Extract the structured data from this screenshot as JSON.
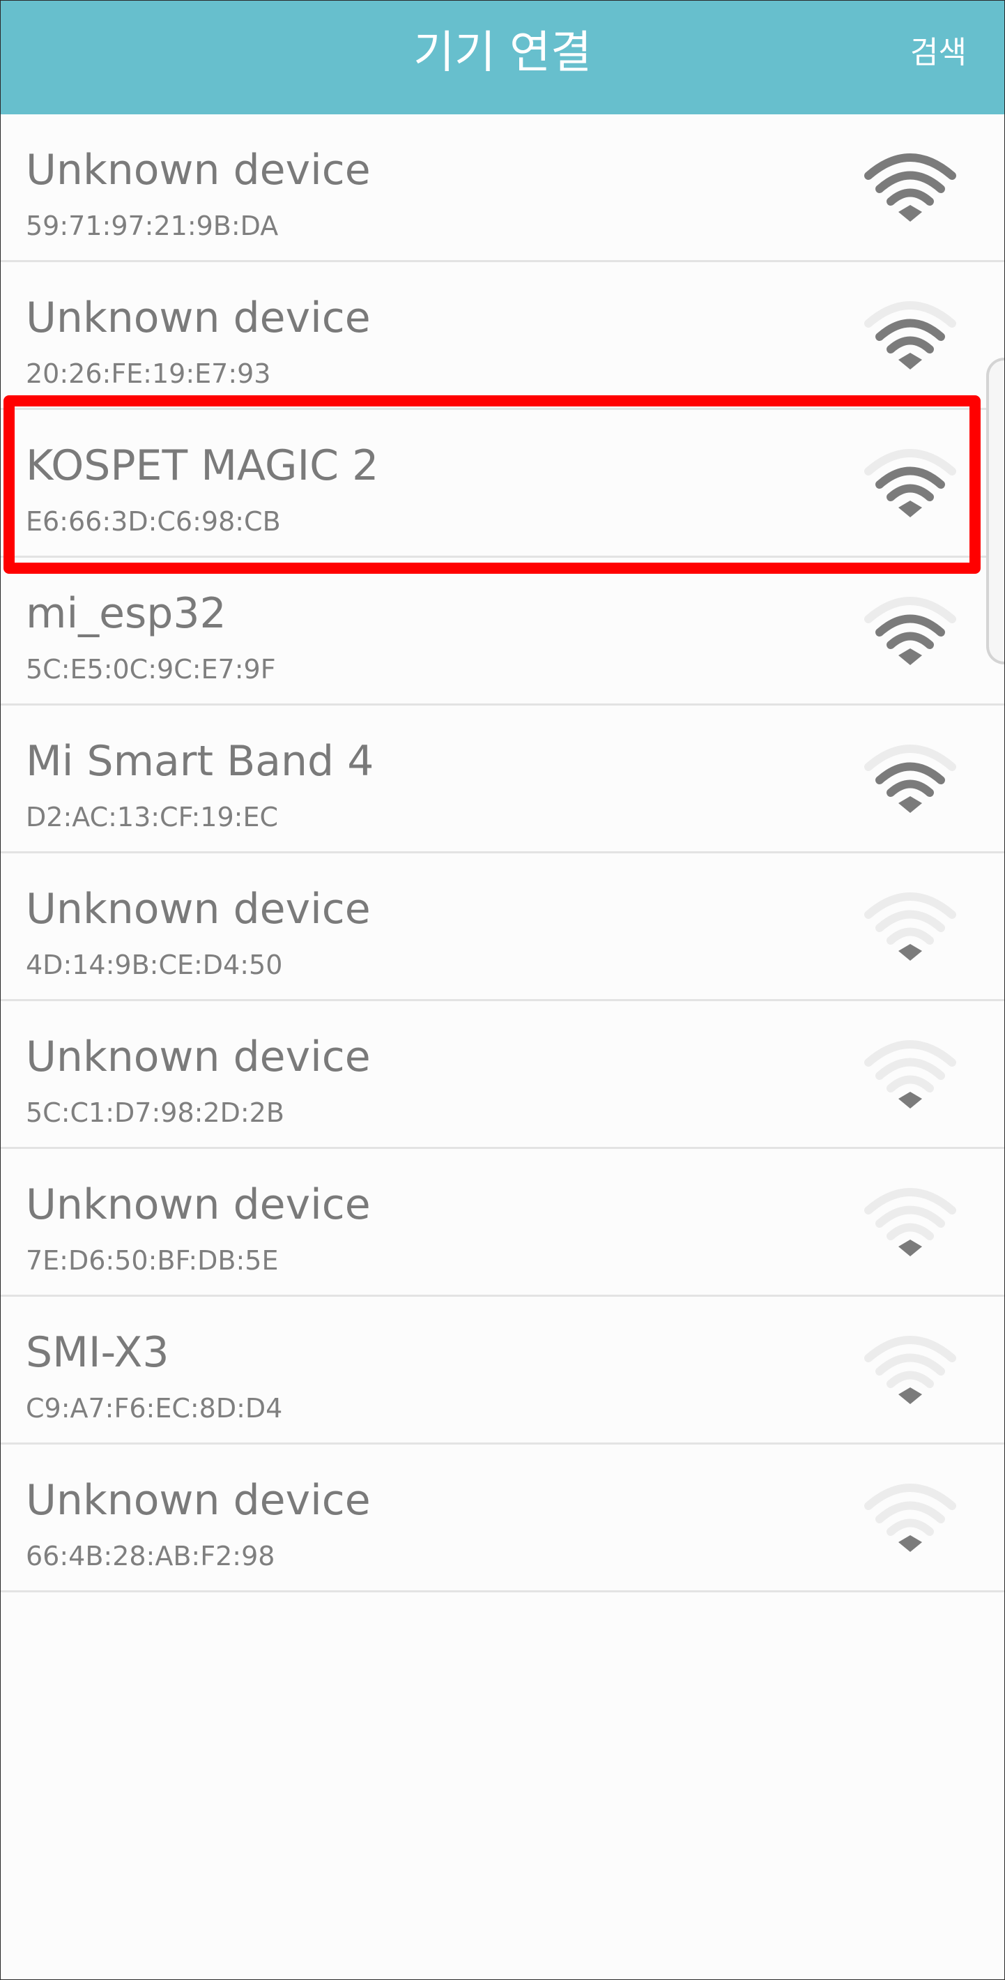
{
  "app_bar": {
    "title": "기기 연결",
    "search_label": "검색"
  },
  "colors": {
    "app_bar": "#67bfcd",
    "signal_active": "#7b7b7b",
    "signal_inactive": "#ececec",
    "highlight": "#ff0000"
  },
  "devices": [
    {
      "name": "Unknown device",
      "mac": "59:71:97:21:9B:DA",
      "signal_bars": 4
    },
    {
      "name": "Unknown device",
      "mac": "20:26:FE:19:E7:93",
      "signal_bars": 3
    },
    {
      "name": "KOSPET MAGIC 2",
      "mac": "E6:66:3D:C6:98:CB",
      "signal_bars": 3,
      "highlighted": true
    },
    {
      "name": "mi_esp32",
      "mac": "5C:E5:0C:9C:E7:9F",
      "signal_bars": 3
    },
    {
      "name": "Mi Smart Band 4",
      "mac": "D2:AC:13:CF:19:EC",
      "signal_bars": 3
    },
    {
      "name": "Unknown device",
      "mac": "4D:14:9B:CE:D4:50",
      "signal_bars": 1
    },
    {
      "name": "Unknown device",
      "mac": "5C:C1:D7:98:2D:2B",
      "signal_bars": 1
    },
    {
      "name": "Unknown device",
      "mac": "7E:D6:50:BF:DB:5E",
      "signal_bars": 1
    },
    {
      "name": "SMI-X3",
      "mac": "C9:A7:F6:EC:8D:D4",
      "signal_bars": 1
    },
    {
      "name": "Unknown device",
      "mac": "66:4B:28:AB:F2:98",
      "signal_bars": 1
    }
  ]
}
